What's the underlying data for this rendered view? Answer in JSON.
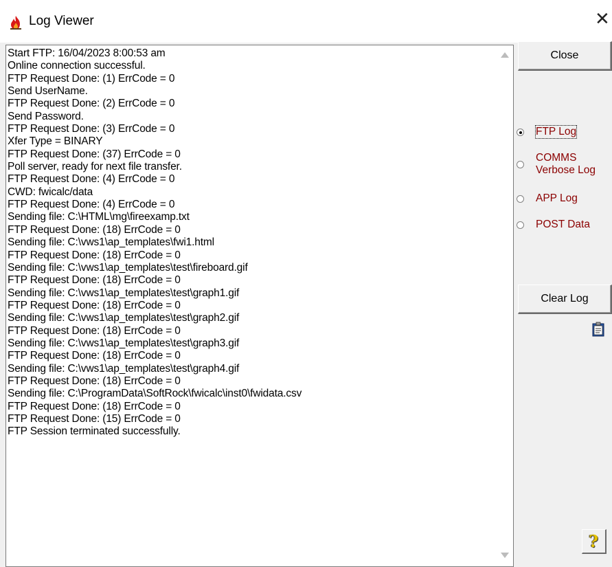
{
  "window": {
    "title": "Log Viewer",
    "close_glyph": "✕",
    "app_icon": "fire-icon"
  },
  "log": {
    "lines": [
      "Start FTP: 16/04/2023 8:00:53 am",
      "Online connection successful.",
      "FTP Request Done: (1) ErrCode = 0",
      "Send UserName.",
      "FTP Request Done: (2) ErrCode = 0",
      "Send Password.",
      "FTP Request Done: (3) ErrCode = 0",
      "Xfer Type = BINARY",
      "FTP Request Done: (37) ErrCode = 0",
      "Poll server, ready for next file transfer.",
      "FTP Request Done: (4) ErrCode = 0",
      "CWD: fwicalc/data",
      "FTP Request Done: (4) ErrCode = 0",
      "Sending file: C:\\HTML\\mg\\fireexamp.txt",
      "FTP Request Done: (18) ErrCode = 0",
      "Sending file: C:\\vws1\\ap_templates\\fwi1.html",
      "FTP Request Done: (18) ErrCode = 0",
      "Sending file: C:\\vws1\\ap_templates\\test\\fireboard.gif",
      "FTP Request Done: (18) ErrCode = 0",
      "Sending file: C:\\vws1\\ap_templates\\test\\graph1.gif",
      "FTP Request Done: (18) ErrCode = 0",
      "Sending file: C:\\vws1\\ap_templates\\test\\graph2.gif",
      "FTP Request Done: (18) ErrCode = 0",
      "Sending file: C:\\vws1\\ap_templates\\test\\graph3.gif",
      "FTP Request Done: (18) ErrCode = 0",
      "Sending file: C:\\vws1\\ap_templates\\test\\graph4.gif",
      "FTP Request Done: (18) ErrCode = 0",
      "Sending file: C:\\ProgramData\\SoftRock\\fwicalc\\inst0\\fwidata.csv",
      "FTP Request Done: (18) ErrCode = 0",
      "FTP Request Done: (15) ErrCode = 0",
      "FTP Session terminated successfully."
    ]
  },
  "buttons": {
    "close": "Close",
    "clear_log": "Clear Log"
  },
  "log_type": {
    "selected": "FTP Log",
    "options": [
      {
        "label_lines": [
          "FTP Log"
        ]
      },
      {
        "label_lines": [
          "COMMS",
          "Verbose Log"
        ]
      },
      {
        "label_lines": [
          "APP Log"
        ]
      },
      {
        "label_lines": [
          "POST Data"
        ]
      }
    ]
  },
  "icons": {
    "clipboard": "clipboard-icon",
    "help": "help-icon"
  },
  "colors": {
    "radio_label": "#8b0000",
    "background": "#f0f0f0"
  }
}
